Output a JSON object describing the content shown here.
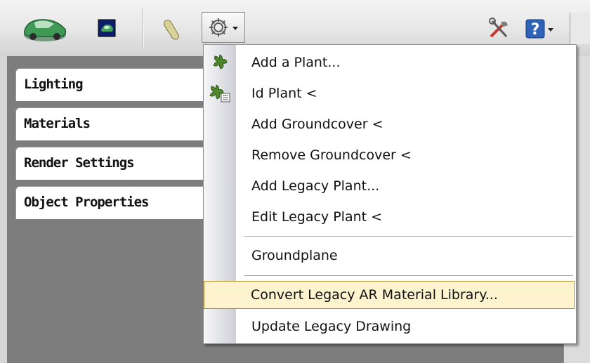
{
  "palette_tabs": [
    {
      "label": "Lighting"
    },
    {
      "label": "Materials"
    },
    {
      "label": "Render Settings"
    },
    {
      "label": "Object Properties"
    }
  ],
  "menu": {
    "items": [
      {
        "label": "Add a Plant..."
      },
      {
        "label": "Id Plant <"
      },
      {
        "label": "Add Groundcover <"
      },
      {
        "label": "Remove Groundcover <"
      },
      {
        "label": "Add Legacy Plant..."
      },
      {
        "label": "Edit Legacy Plant <"
      },
      {
        "label": "Groundplane"
      },
      {
        "label": "Convert Legacy AR Material Library..."
      },
      {
        "label": "Update Legacy Drawing"
      }
    ],
    "highlighted_item": "Convert Legacy AR Material Library..."
  },
  "icons": {
    "toolbar": [
      "car-render-icon",
      "render-window-icon",
      "foot-tool-icon",
      "gear-icon",
      "tools-icon",
      "help-icon"
    ],
    "menu": [
      "plant-add-icon",
      "plant-id-icon"
    ]
  },
  "colors": {
    "highlight_bg": "#fdf3cf",
    "highlight_border": "#b08d2f",
    "panel_bg": "#7d7d7d"
  }
}
